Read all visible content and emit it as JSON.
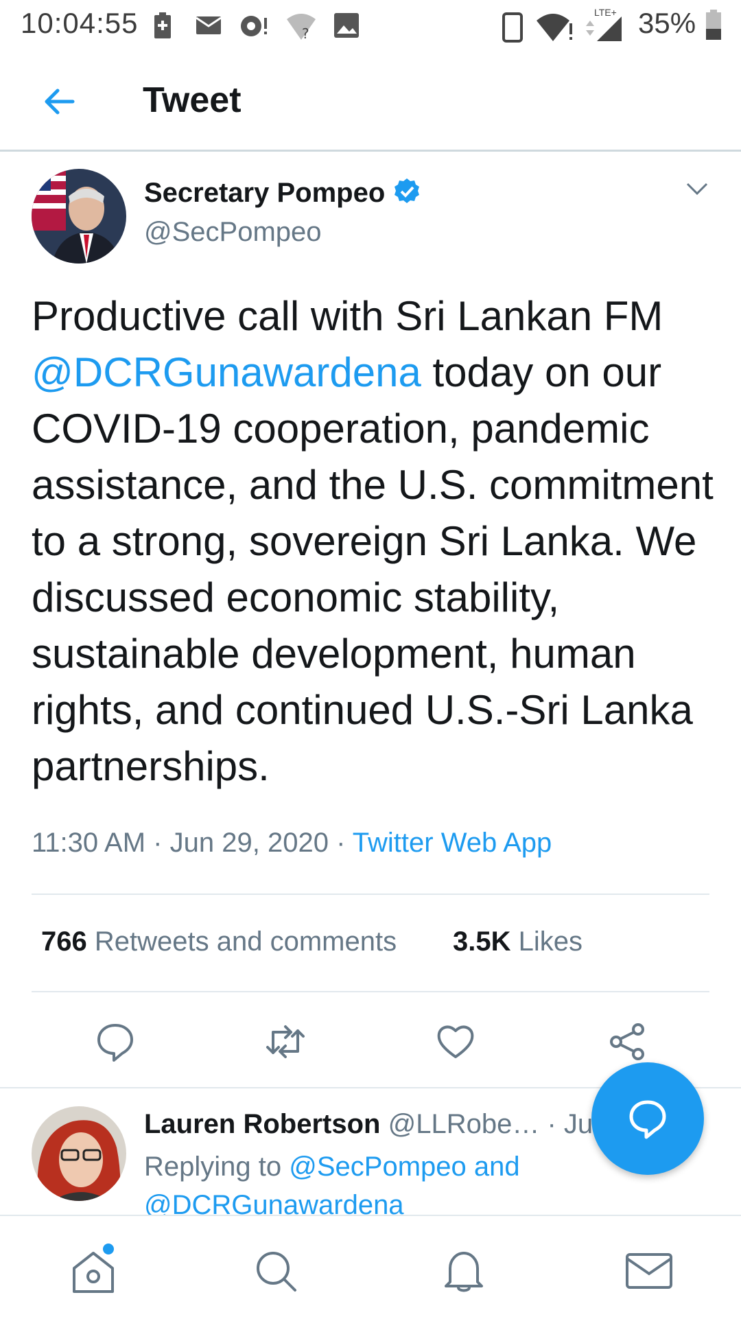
{
  "status_bar": {
    "time": "10:04:55",
    "battery_percent": "35%",
    "network": "LTE+"
  },
  "header": {
    "back_icon": "arrow-left-icon",
    "title": "Tweet"
  },
  "tweet": {
    "author_name": "Secretary Pompeo",
    "author_handle": "@SecPompeo",
    "verified": true,
    "text_before_mention": "Productive call with Sri Lankan FM",
    "mention": "@DCRGunawardena",
    "text_after_mention": " today on our COVID-19 cooperation, pandemic assistance, and the U.S. commitment to a strong, sovereign Sri Lanka. We discussed economic stability, sustainable development, human rights, and continued U.S.-Sri Lanka partnerships.",
    "time": "11:30 AM",
    "separator": "·",
    "date": "Jun 29, 2020",
    "source": "Twitter Web App",
    "retweets_count": "766",
    "retweets_label": "Retweets and comments",
    "likes_count": "3.5K",
    "likes_label": "Likes"
  },
  "reply": {
    "author_name": "Lauren Robertson",
    "author_handle": "@LLRobe…",
    "date_fragment": "· Ju",
    "replying_prefix": "Replying to",
    "replying_to_1": "@SecPompeo and",
    "replying_to_2": "@DCRGunawardena"
  },
  "colors": {
    "accent": "#1d9bf0",
    "secondary_text": "#657786",
    "divider": "#e1e8ed"
  }
}
